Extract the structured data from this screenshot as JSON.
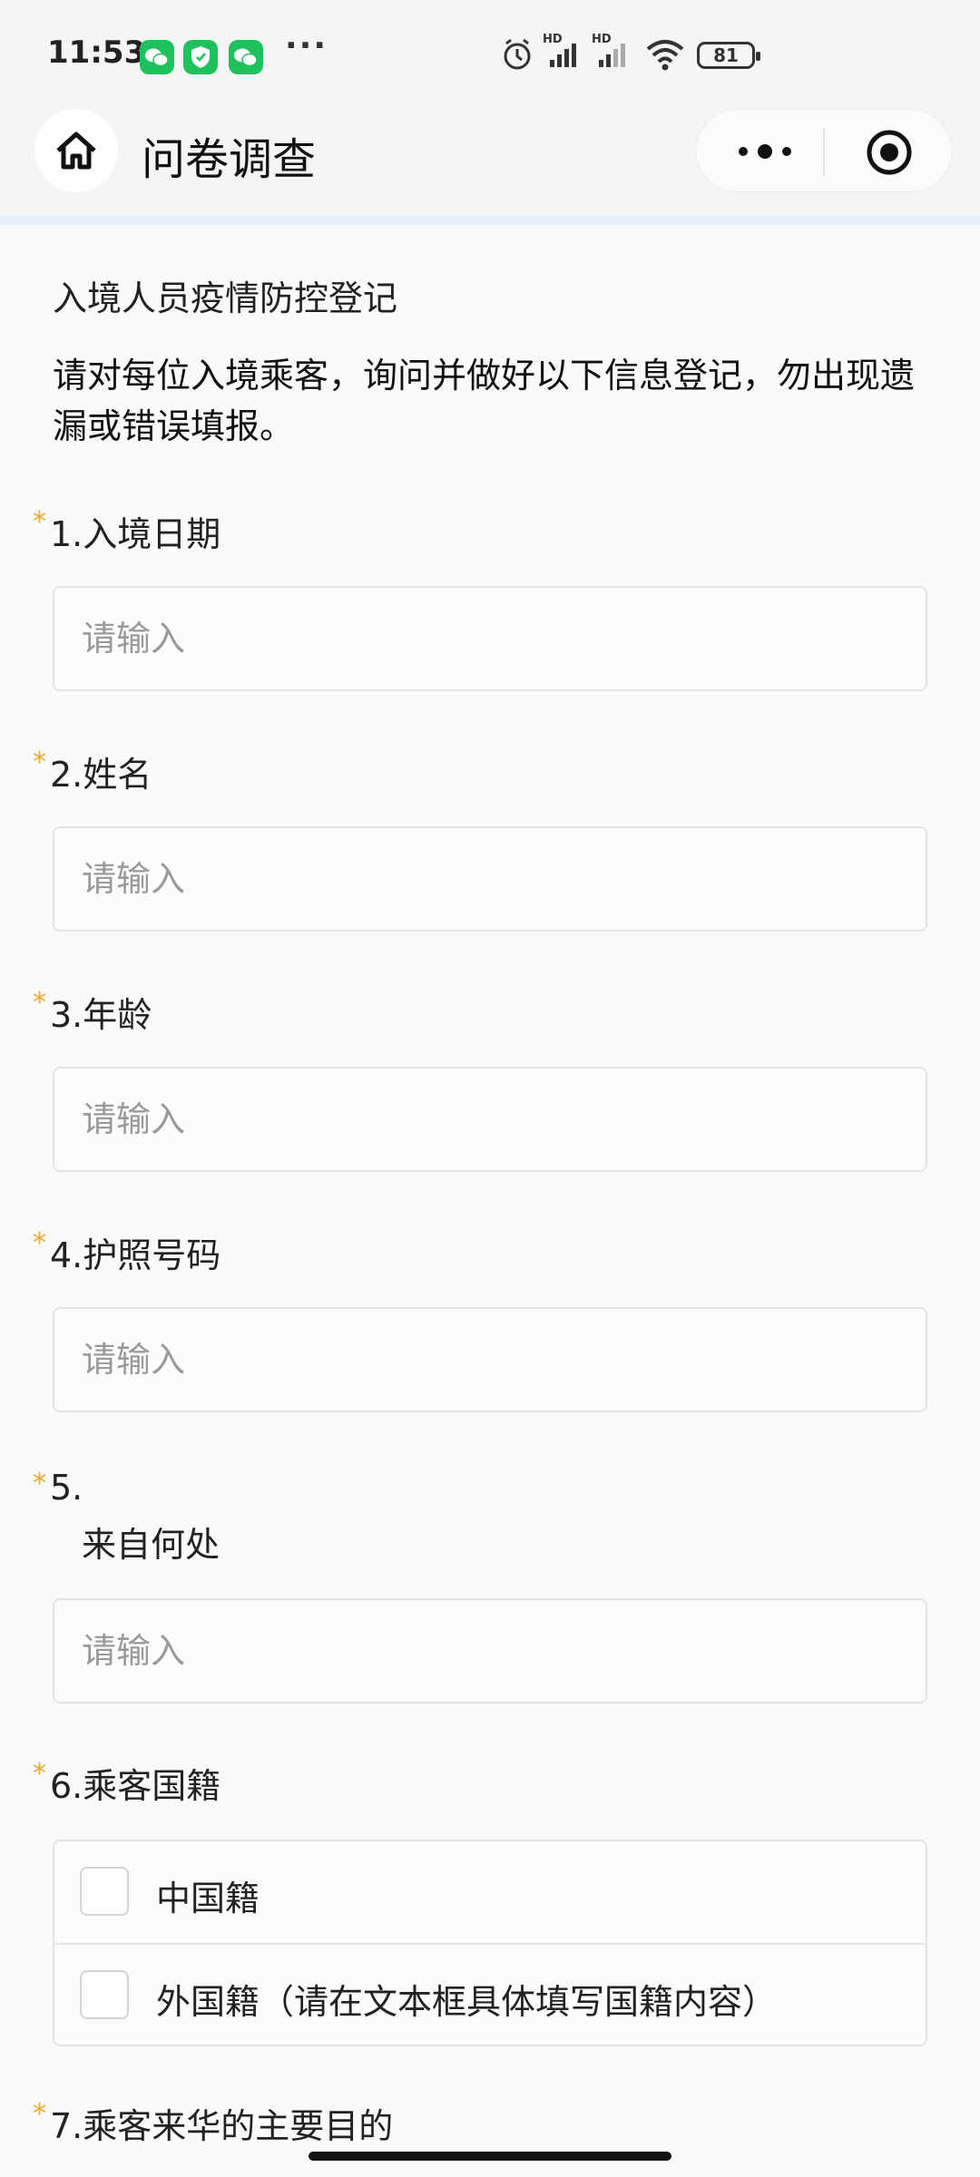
{
  "status_bar": {
    "time": "11:53",
    "app_icons": [
      "wechat-icon",
      "security-shield-icon",
      "wechat-icon"
    ],
    "overflow": "···",
    "battery": "81",
    "signal_label_1": "HD",
    "signal_label_2": "HD"
  },
  "navbar": {
    "title": "问卷调查"
  },
  "survey": {
    "title": "入境人员疫情防控登记",
    "description": "请对每位入境乘客，询问并做好以下信息登记，勿出现遗漏或错误填报。"
  },
  "questions": [
    {
      "required": "*",
      "number": "1.",
      "label": "入境日期",
      "placeholder": "请输入"
    },
    {
      "required": "*",
      "number": "2.",
      "label": "姓名",
      "placeholder": "请输入"
    },
    {
      "required": "*",
      "number": "3.",
      "label": "年龄",
      "placeholder": "请输入"
    },
    {
      "required": "*",
      "number": "4.",
      "label": "护照号码",
      "placeholder": "请输入"
    },
    {
      "required": "*",
      "number": "5.",
      "label": "来自何处",
      "placeholder": "请输入"
    },
    {
      "required": "*",
      "number": "6.",
      "label": "乘客国籍",
      "options": [
        "中国籍",
        "外国籍（请在文本框具体填写国籍内容）"
      ]
    },
    {
      "required": "*",
      "number": "7.",
      "label": "乘客来华的主要目的"
    }
  ],
  "colors": {
    "required_star": "#e8a82b",
    "accent_bar": "#e6f0fa",
    "placeholder": "#9a9a9a"
  }
}
